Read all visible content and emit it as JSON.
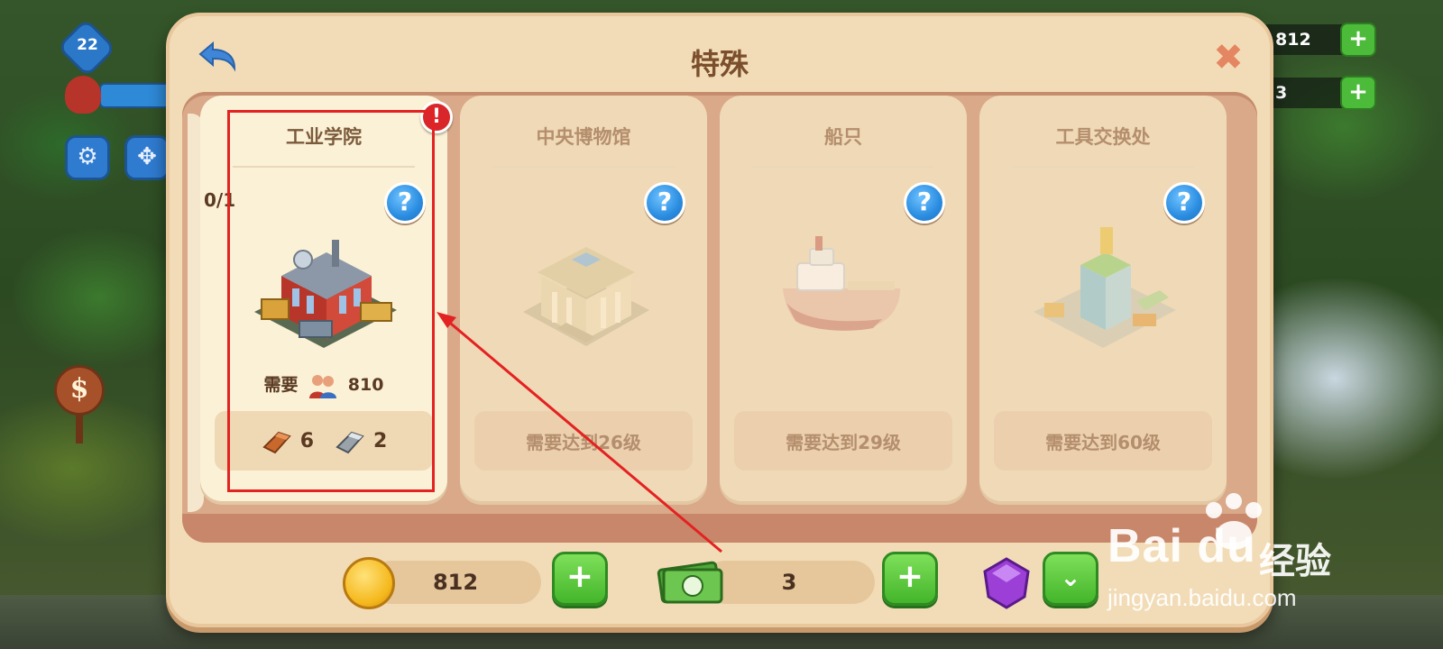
{
  "hud": {
    "level": "22",
    "coins_top": "812",
    "cash_top": "3",
    "sign_symbol": "$"
  },
  "dialog": {
    "title": "特殊",
    "back_icon": "back-arrow-icon",
    "close_icon": "close-icon"
  },
  "cards": [
    {
      "title": "工业学院",
      "count": "0/1",
      "alert": "!",
      "require_label": "需要",
      "require_value": "810",
      "costs": [
        {
          "icon": "copper-ingot-icon",
          "value": "6"
        },
        {
          "icon": "iron-ingot-icon",
          "value": "2"
        }
      ],
      "locked": false
    },
    {
      "title": "中央博物馆",
      "lock_text": "需要达到26级",
      "locked": true
    },
    {
      "title": "船只",
      "lock_text": "需要达到29级",
      "locked": true
    },
    {
      "title": "工具交换处",
      "lock_text": "需要达到60级",
      "locked": true
    }
  ],
  "help_symbol": "?",
  "currency": {
    "coins": "812",
    "cash": "3",
    "plus_symbol": "+",
    "expand_symbol": "⌄"
  },
  "watermark": {
    "brand": "Bai du",
    "sub": "经验",
    "url": "jingyan.baidu.com"
  },
  "colors": {
    "dialog_bg": "#f2dcb7",
    "title": "#7b4f2e",
    "highlight": "#e32222",
    "alert": "#d8262b",
    "plus_green": "#43b52a",
    "help_blue": "#2a8ce0"
  }
}
